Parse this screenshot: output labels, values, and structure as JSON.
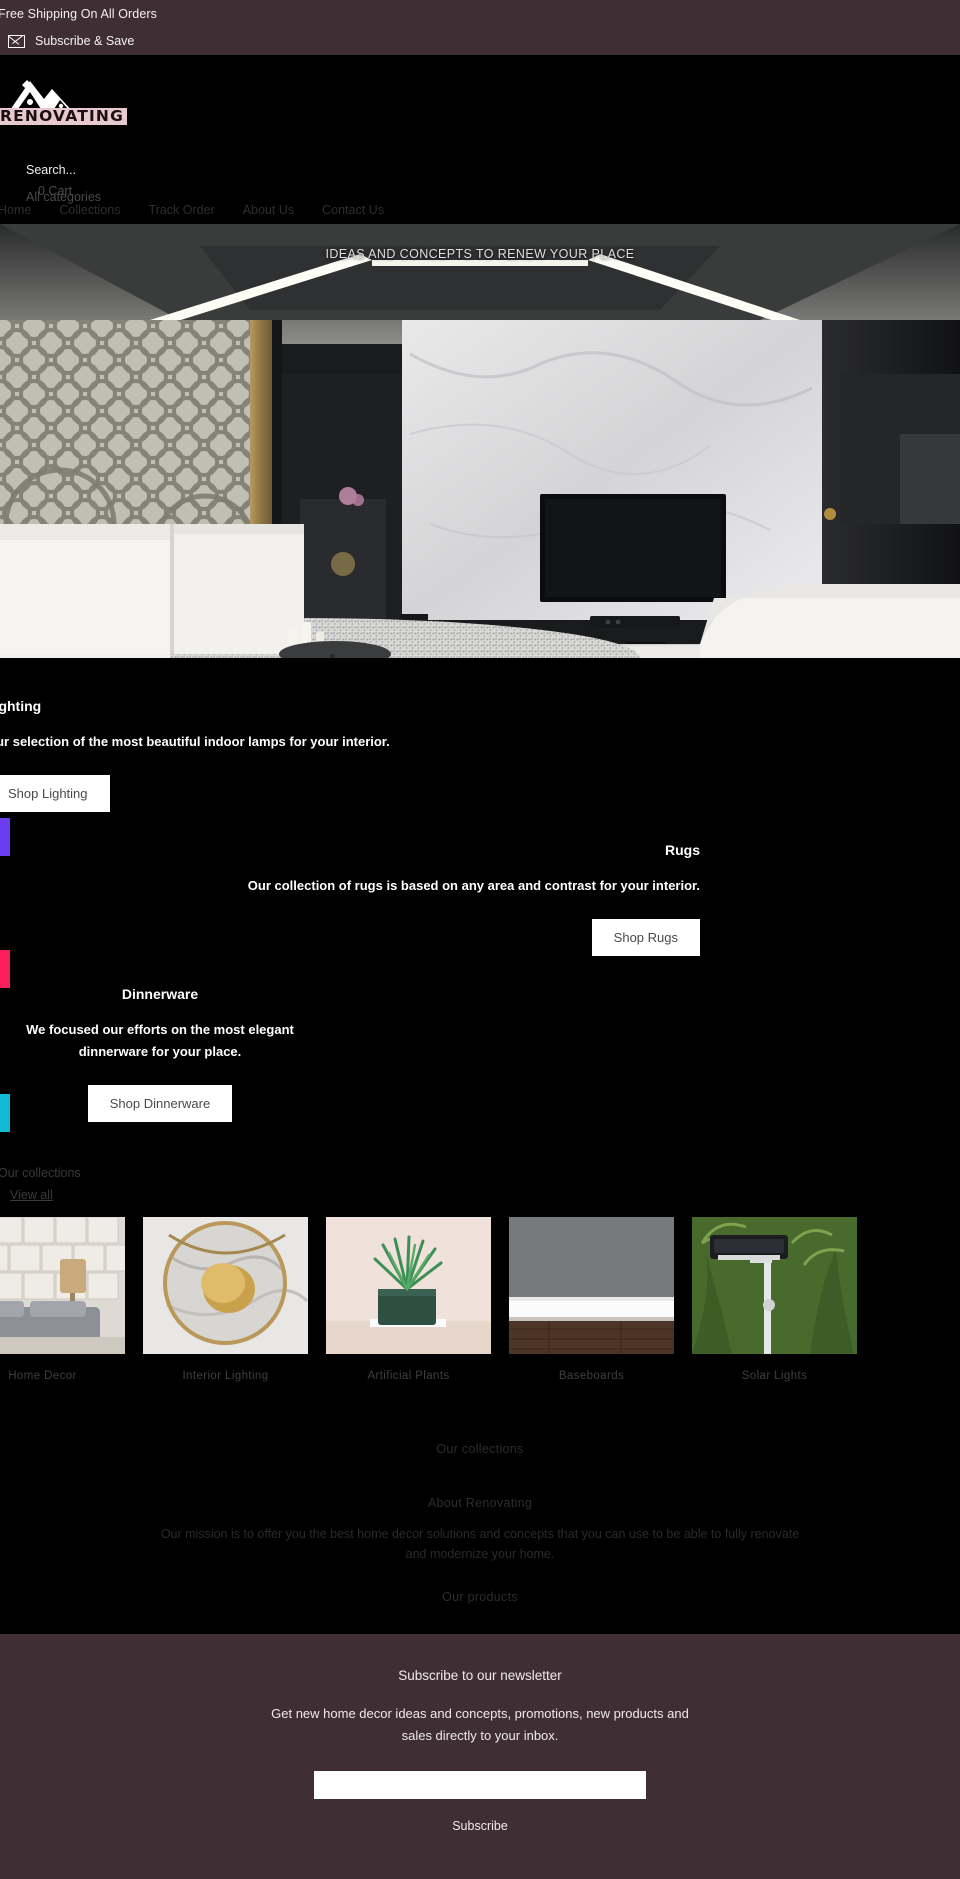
{
  "announcement": {
    "free_shipping": "Free Shipping On All Orders",
    "subscribe_label": "Subscribe & Save",
    "icon": "mail-icon",
    "bg_color": "#3f2f35"
  },
  "header": {
    "logo_text": "RENOVATING",
    "logo_icon": "mountain-house-logo-icon",
    "search_placeholder": "Search...",
    "categories_label": "All categories",
    "cart_label": "0 Cart",
    "cart_icon": "cart-icon",
    "search_icon": "search-icon"
  },
  "nav": {
    "items": [
      {
        "label": "Home"
      },
      {
        "label": "Collections"
      },
      {
        "label": "Track Order"
      },
      {
        "label": "About Us"
      },
      {
        "label": "Contact Us"
      }
    ]
  },
  "hero": {
    "caption": "IDEAS AND CONCEPTS TO RENEW YOUR PLACE",
    "alt": "modern living room with large wall mounted tv, marble wall panel and white sofa"
  },
  "features": [
    {
      "title": "Lighting",
      "body": "Our selection of the most beautiful indoor lamps for your interior.",
      "button": "Shop Lighting",
      "accent": "#6b3df0"
    },
    {
      "title": "Rugs",
      "body": "Our collection of rugs is based on any area and contrast for your interior.",
      "button": "Shop Rugs",
      "accent": "#f8215c"
    },
    {
      "title": "Dinnerware",
      "body": "We focused our efforts on the most elegant dinnerware for your place.",
      "button": "Shop Dinnerware",
      "accent": "#12b9d4"
    }
  ],
  "collections": {
    "title": "Our collections",
    "view_all": "View all",
    "cards": [
      {
        "caption": "Home Decor"
      },
      {
        "caption": "Interior Lighting"
      },
      {
        "caption": "Artificial Plants"
      },
      {
        "caption": "Baseboards"
      },
      {
        "caption": "Solar Lights"
      }
    ]
  },
  "sections": {
    "our_collections_heading": "Our collections",
    "about_heading": "About Renovating",
    "about_body": "Our mission is to offer you the best home decor solutions and concepts that you can use to be able to fully renovate and modernize your home.",
    "our_products_heading": "Our products"
  },
  "newsletter": {
    "heading": "Subscribe to our newsletter",
    "body": "Get new home decor ideas and concepts, promotions, new products and sales directly to your inbox.",
    "input_value": "",
    "input_placeholder": "",
    "button": "Subscribe",
    "bg_color": "#3f2f35"
  }
}
